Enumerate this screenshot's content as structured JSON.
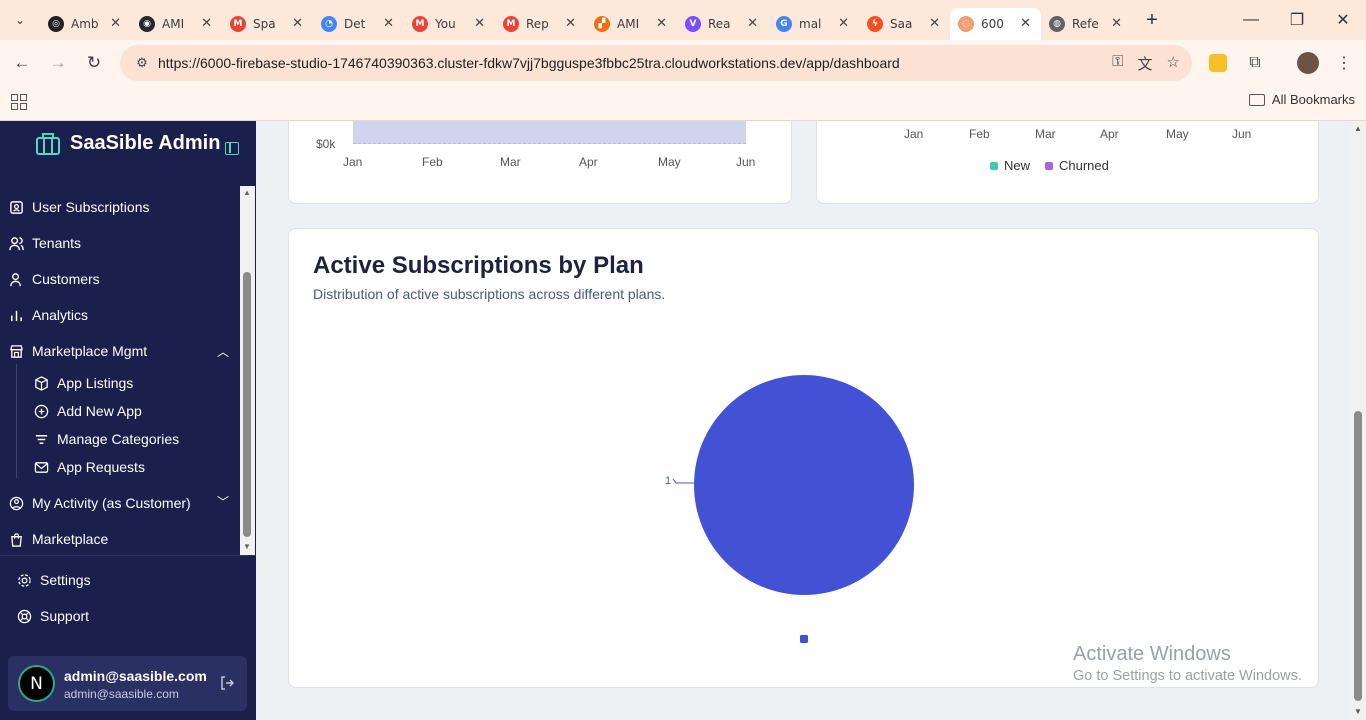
{
  "browser": {
    "tabs": [
      {
        "title": "Amb",
        "fav_color": "#222222",
        "fav_glyph": "◎"
      },
      {
        "title": "AMI",
        "fav_color": "#24292f",
        "fav_glyph": "◉"
      },
      {
        "title": "Spa",
        "fav_color": "#ea4335",
        "fav_glyph": "M"
      },
      {
        "title": "Det",
        "fav_color": "#4285f4",
        "fav_glyph": "◔"
      },
      {
        "title": "You",
        "fav_color": "#ea4335",
        "fav_glyph": "M"
      },
      {
        "title": "Rep",
        "fav_color": "#ea4335",
        "fav_glyph": "M"
      },
      {
        "title": "AMI",
        "fav_color": "#f46b0a",
        "fav_glyph": "▞"
      },
      {
        "title": "Rea",
        "fav_color": "#7b4dff",
        "fav_glyph": "V"
      },
      {
        "title": "mal",
        "fav_color": "#4285f4",
        "fav_glyph": "G"
      },
      {
        "title": "Saa",
        "fav_color": "#f4511e",
        "fav_glyph": "ϟ"
      },
      {
        "title": "600",
        "fav_color": "#f29e74",
        "fav_glyph": "◌",
        "active": true
      },
      {
        "title": "Refe",
        "fav_color": "#5f6368",
        "fav_glyph": "◍"
      }
    ],
    "url": "https://6000-firebase-studio-1746740390363.cluster-fdkw7vjj7bgguspe3fbbc25tra.cloudworkstations.dev/app/dashboard",
    "all_bookmarks_label": "All Bookmarks"
  },
  "sidebar": {
    "brand_title": "SaaSible Admin",
    "items": [
      {
        "label": "User Subscriptions",
        "icon": "subscriptions-icon"
      },
      {
        "label": "Tenants",
        "icon": "users-icon"
      },
      {
        "label": "Customers",
        "icon": "user-icon"
      },
      {
        "label": "Analytics",
        "icon": "bar-chart-icon"
      },
      {
        "label": "Marketplace Mgmt",
        "icon": "store-icon"
      }
    ],
    "sub_items": [
      {
        "label": "App Listings",
        "icon": "package-icon"
      },
      {
        "label": "Add New App",
        "icon": "plus-circle-icon"
      },
      {
        "label": "Manage Categories",
        "icon": "filter-icon"
      },
      {
        "label": "App Requests",
        "icon": "mail-icon"
      }
    ],
    "items_after": [
      {
        "label": "My Activity (as Customer)",
        "icon": "activity-icon"
      },
      {
        "label": "Marketplace",
        "icon": "shopping-bag-icon"
      }
    ],
    "bottom": [
      {
        "label": "Settings",
        "icon": "gear-icon"
      },
      {
        "label": "Support",
        "icon": "lifebuoy-icon"
      }
    ],
    "user": {
      "avatar_letter": "N",
      "name": "admin@saasible.com",
      "email": "admin@saasible.com"
    }
  },
  "revenue_card": {
    "y_tick": "$0k",
    "months": [
      "Jan",
      "Feb",
      "Mar",
      "Apr",
      "May",
      "Jun"
    ],
    "bar_color": "#d2d3ee"
  },
  "churn_card": {
    "months": [
      "Jan",
      "Feb",
      "Mar",
      "Apr",
      "May",
      "Jun"
    ],
    "legend": [
      {
        "label": "New",
        "color": "#3ec9b4"
      },
      {
        "label": "Churned",
        "color": "#a166e0"
      }
    ]
  },
  "plan_card": {
    "title": "Active Subscriptions by Plan",
    "description": "Distribution of active subscriptions across different plans.",
    "chart_data": {
      "type": "pie",
      "slices": [
        {
          "value": 1,
          "color": "#4352d4"
        }
      ],
      "data_labels": [
        "1"
      ]
    }
  },
  "os_watermark": {
    "line1": "Activate Windows",
    "line2": "Go to Settings to activate Windows."
  }
}
